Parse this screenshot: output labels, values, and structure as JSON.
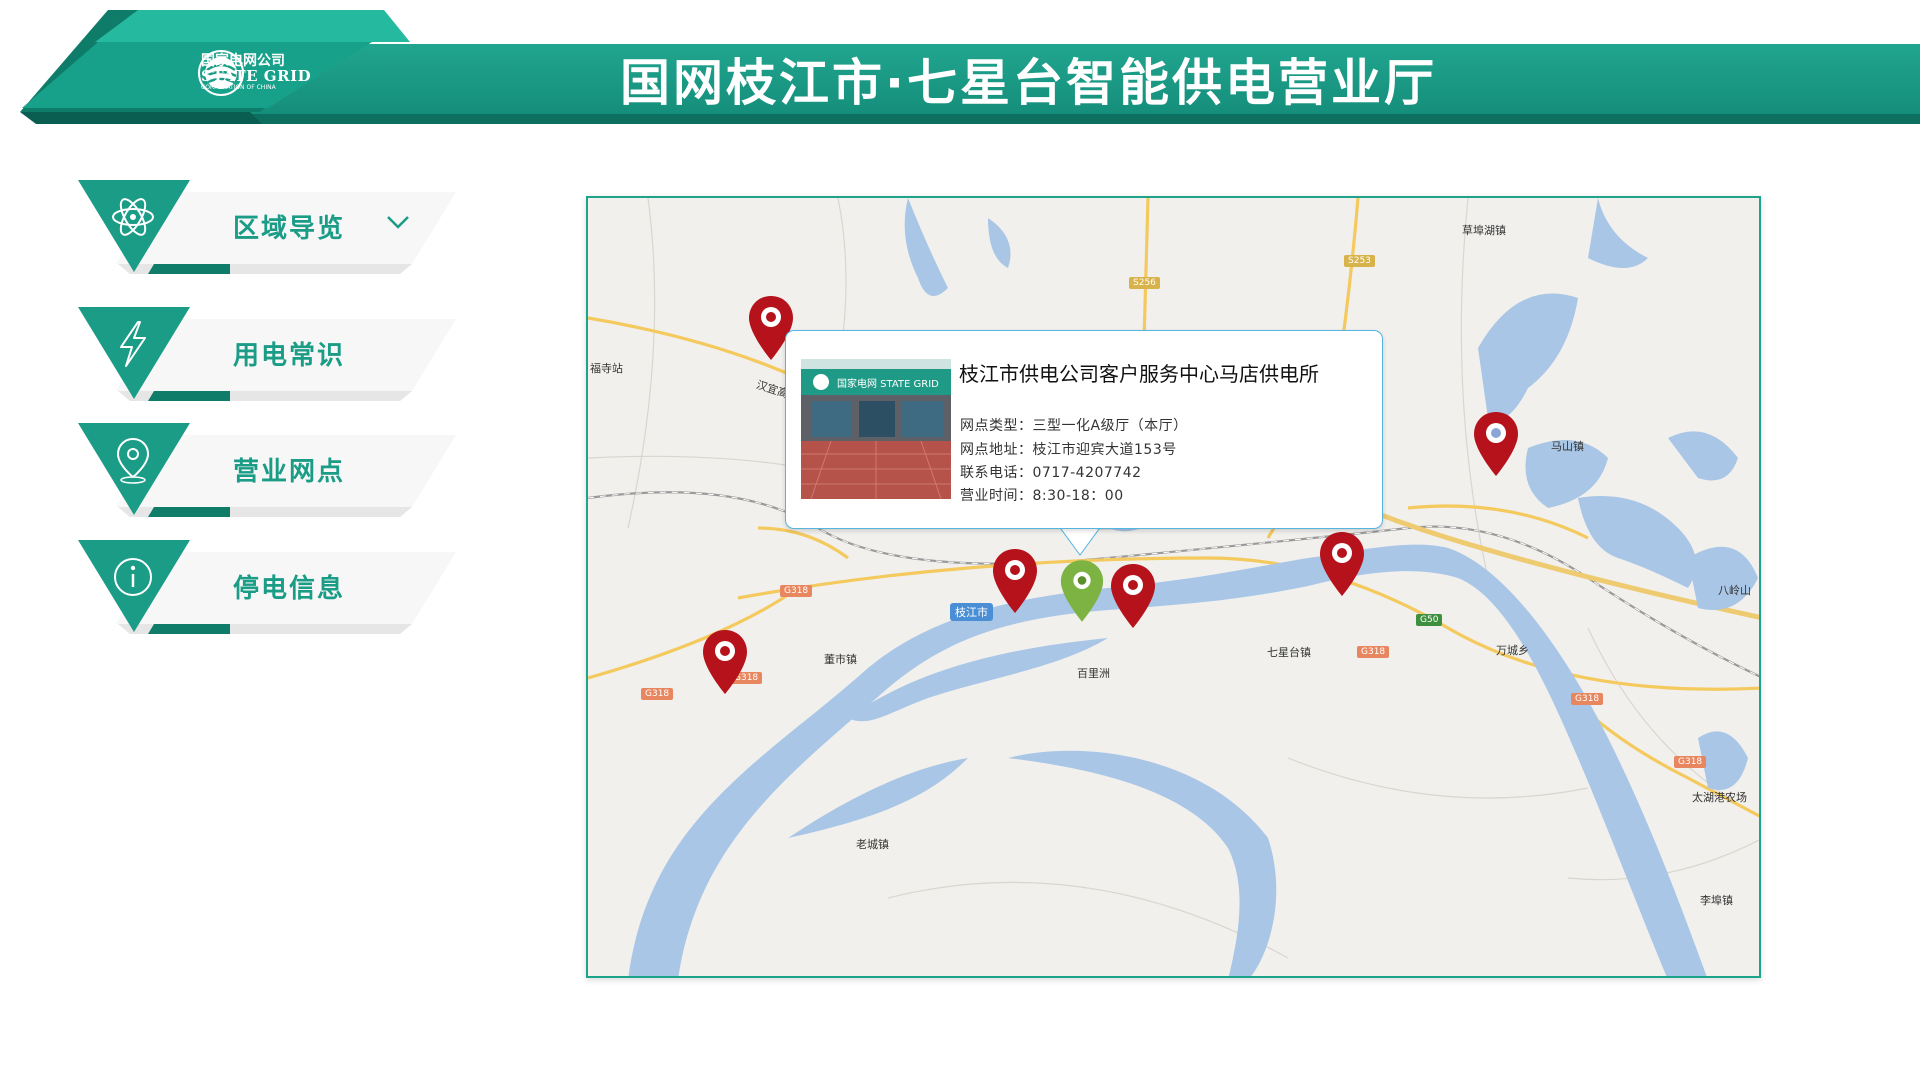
{
  "header": {
    "title": "国网枝江市·七星台智能供电营业厅",
    "logo_cn": "国家电网公司",
    "logo_en": "STATE GRID",
    "logo_sub": "CORPORATION OF CHINA"
  },
  "menu": {
    "items": [
      {
        "label": "区域导览",
        "icon": "atom-icon",
        "has_dropdown": true
      },
      {
        "label": "用电常识",
        "icon": "lightning-icon"
      },
      {
        "label": "营业网点",
        "icon": "location-pin-icon"
      },
      {
        "label": "停电信息",
        "icon": "info-icon"
      }
    ]
  },
  "map": {
    "places": {
      "caobuhu": "草埠湖镇",
      "mashan": "马山镇",
      "bailingshan": "八岭山",
      "wanchengxiang": "万城乡",
      "qixingtai": "七星台镇",
      "dongshi": "董市镇",
      "bailizhou": "百里洲",
      "laocheng": "老城镇",
      "taihugang": "太湖港农场",
      "libu": "李埠镇",
      "fusi": "福寺站",
      "hanyi": "汉宜高"
    },
    "city_tag": "枝江市",
    "shields": {
      "s256": "S256",
      "s253": "S253",
      "g318": "G318",
      "g50": "G50"
    }
  },
  "popup": {
    "title": "枝江市供电公司客户服务中心马店供电所",
    "type_label": "网点类型：",
    "type_value": "三型一化A级厅（本厅）",
    "address_label": "网点地址：",
    "address_value": "枝江市迎宾大道153号",
    "phone_label": "联系电话：",
    "phone_value": "0717-4207742",
    "hours_label": "营业时间：",
    "hours_value": "8:30-18：00",
    "photo_sign": "国家电网 STATE GRID"
  },
  "colors": {
    "brand_green": "#1a9c86",
    "header_dark": "#0c6f5f",
    "pin_red": "#b5121b",
    "pin_active": "#7cb342",
    "water": "#a9c6e6",
    "popup_border": "#55b4e0"
  }
}
